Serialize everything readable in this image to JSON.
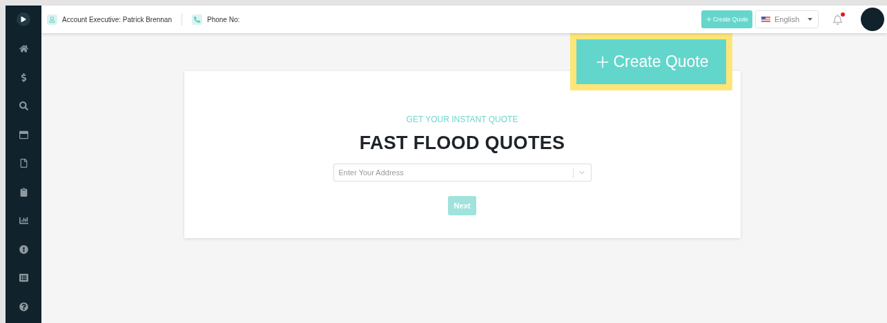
{
  "header": {
    "account_executive": "Account Executive: Patrick Brennan",
    "phone": "Phone No:",
    "create_quote_button": "Create Quote",
    "language": "English",
    "notification_unread": true
  },
  "callout": {
    "label": "Create Quote"
  },
  "quote_card": {
    "eyebrow": "GET YOUR INSTANT QUOTE",
    "title": "FAST FLOOD QUOTES",
    "address_field": {
      "placeholder": "Enter Your Address"
    },
    "next_button": {
      "label": "Next",
      "disabled": true
    }
  }
}
